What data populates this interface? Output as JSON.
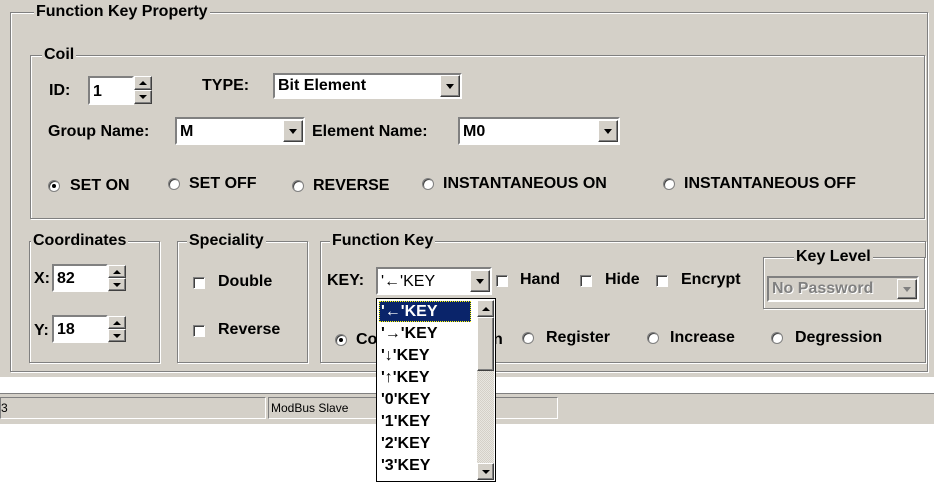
{
  "function_key_property": {
    "title": "Function Key Property",
    "coil": {
      "title": "Coil",
      "id_label": "ID:",
      "id_value": "1",
      "type_label": "TYPE:",
      "type_value": "Bit Element",
      "group_name_label": "Group Name:",
      "group_name_value": "M",
      "element_name_label": "Element Name:",
      "element_name_value": "M0",
      "modes": [
        {
          "label": "SET ON",
          "selected": true
        },
        {
          "label": "SET OFF",
          "selected": false
        },
        {
          "label": "REVERSE",
          "selected": false
        },
        {
          "label": "INSTANTANEOUS ON",
          "selected": false
        },
        {
          "label": "INSTANTANEOUS OFF",
          "selected": false
        }
      ]
    },
    "coordinates": {
      "title": "Coordinates",
      "x_label": "X:",
      "x_value": "82",
      "y_label": "Y:",
      "y_value": "18"
    },
    "speciality": {
      "title": "Speciality",
      "double_label": "Double",
      "reverse_label": "Reverse"
    },
    "function_key": {
      "title": "Function Key",
      "key_label": "KEY:",
      "key_value": "'←'KEY",
      "hand_label": "Hand",
      "hide_label": "Hide",
      "encrypt_label": "Encrypt",
      "key_level": {
        "title": "Key Level",
        "value": "No Password"
      },
      "modes": [
        {
          "label": "Co",
          "selected": true
        },
        {
          "label": "n",
          "selected": false
        },
        {
          "label": "Register",
          "selected": false
        },
        {
          "label": "Increase",
          "selected": false
        },
        {
          "label": "Degression",
          "selected": false
        }
      ]
    },
    "key_dropdown": {
      "options": [
        "'←'KEY",
        "'→'KEY",
        "'↓'KEY",
        "'↑'KEY",
        "'0'KEY",
        "'1'KEY",
        "'2'KEY",
        "'3'KEY"
      ],
      "selected_index": 0
    }
  },
  "status_bar": {
    "cell1": "3",
    "cell2": "ModBus Slave"
  }
}
